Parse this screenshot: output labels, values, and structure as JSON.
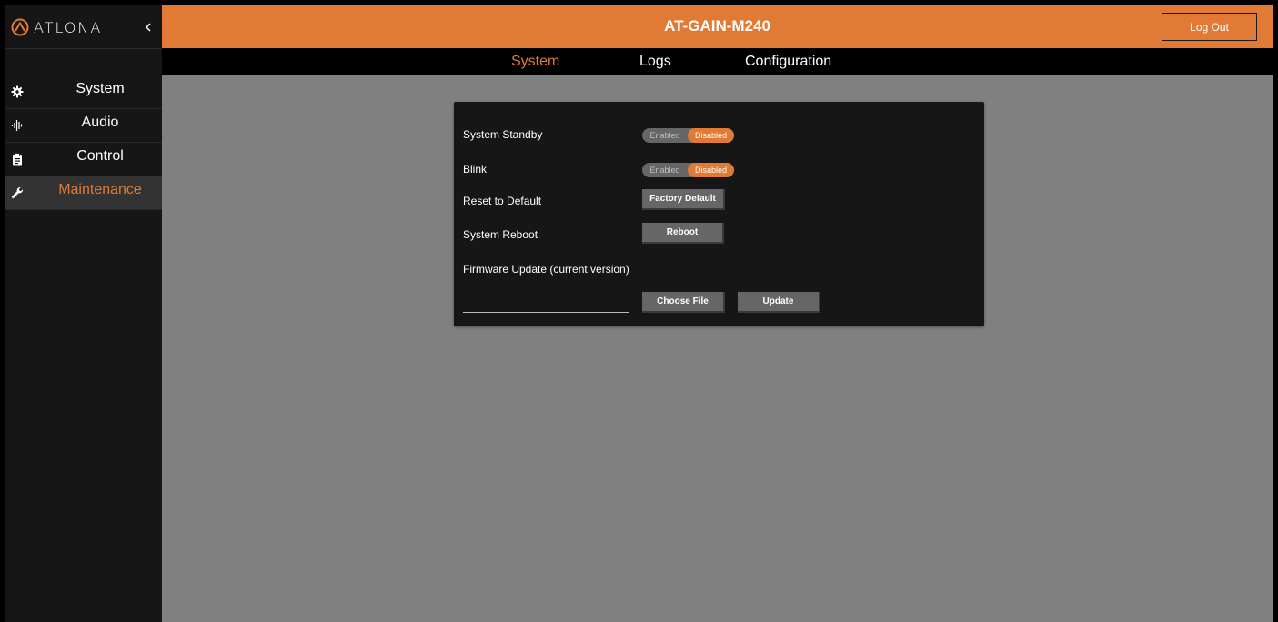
{
  "brand": {
    "name": "ATLONA",
    "logo_icon": "atlona-logo-icon",
    "collapse_icon": "chevron-left-icon"
  },
  "header": {
    "title": "AT-GAIN-M240",
    "logout_label": "Log Out"
  },
  "colors": {
    "accent": "#e07a35",
    "sidebar": "#161616",
    "content": "#808080",
    "panel": "#161616"
  },
  "sidebar": {
    "items": [
      {
        "label": "System",
        "icon": "gear-icon",
        "active": false
      },
      {
        "label": "Audio",
        "icon": "waveform-icon",
        "active": false
      },
      {
        "label": "Control",
        "icon": "clipboard-icon",
        "active": false
      },
      {
        "label": "Maintenance",
        "icon": "wrench-icon",
        "active": true
      }
    ]
  },
  "tabs": [
    {
      "label": "System",
      "active": true
    },
    {
      "label": "Logs",
      "active": false
    },
    {
      "label": "Configuration",
      "active": false
    }
  ],
  "panel": {
    "standby": {
      "label": "System Standby",
      "enabled_label": "Enabled",
      "disabled_label": "Disabled",
      "state": "Disabled"
    },
    "blink": {
      "label": "Blink",
      "enabled_label": "Enabled",
      "disabled_label": "Disabled",
      "state": "Disabled"
    },
    "reset": {
      "label": "Reset to Default",
      "button": "Factory Default"
    },
    "reboot": {
      "label": "System Reboot",
      "button": "Reboot"
    },
    "firmware": {
      "label": "Firmware Update (current version)",
      "file_value": "",
      "choose_button": "Choose File",
      "update_button": "Update"
    }
  }
}
